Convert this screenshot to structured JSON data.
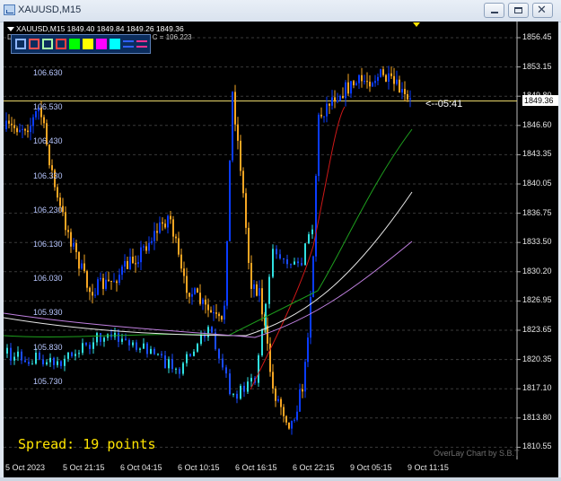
{
  "window": {
    "title": "XAUUSD,M15",
    "app_icon": "chart-icon",
    "controls": [
      "minimize-icon",
      "maximize-icon",
      "close-icon"
    ]
  },
  "chart": {
    "info_line": "XAUUSD,M15  1849.40 1849.84 1849.26 1849.36",
    "indicator_line": "D",
    "indicator_suffix": "103, C = 106.223",
    "current_price": "1849.36",
    "bar_timer": "<--05:41",
    "spread_text": "Spread: 19 points",
    "watermark": "OverLay Chart by S.B.T",
    "colors": {
      "background": "#000000",
      "bull": "#0a3cff",
      "bear": "#f5a623",
      "overlay": "#30e0e0",
      "ma_red": "#d01818",
      "ma_green": "#1ea01e",
      "ma_white": "#e8e8e8",
      "ma_violet": "#c080e0"
    },
    "toolbar_swatches": [
      {
        "name": "toolbar-swatch-1",
        "color": "#8fb6ff",
        "style": "outline"
      },
      {
        "name": "toolbar-swatch-2",
        "color": "#ff5050",
        "style": "outline"
      },
      {
        "name": "toolbar-swatch-3",
        "color": "#a8ffa8",
        "style": "outline"
      },
      {
        "name": "toolbar-swatch-4",
        "color": "#ff4040",
        "style": "outline"
      },
      {
        "name": "toolbar-swatch-5",
        "color": "#00ff00",
        "style": "fill"
      },
      {
        "name": "toolbar-swatch-6",
        "color": "#ffff00",
        "style": "fill"
      },
      {
        "name": "toolbar-swatch-7",
        "color": "#ff00ff",
        "style": "fill"
      },
      {
        "name": "toolbar-swatch-8",
        "color": "#00ffff",
        "style": "fill"
      },
      {
        "name": "toolbar-swatch-9",
        "color": "#3060ff",
        "style": "line"
      },
      {
        "name": "toolbar-swatch-10",
        "color": "#ff3090",
        "style": "line"
      }
    ]
  },
  "chart_data": {
    "type": "candlestick",
    "right_axis_labels": [
      "1856.45",
      "1853.15",
      "1849.80",
      "1846.60",
      "1843.35",
      "1840.05",
      "1836.75",
      "1833.50",
      "1830.20",
      "1826.95",
      "1823.65",
      "1820.35",
      "1817.10",
      "1813.80",
      "1810.55"
    ],
    "left_axis_labels": [
      "106.630",
      "106.530",
      "106.430",
      "106.330",
      "106.230",
      "106.130",
      "106.030",
      "105.930",
      "105.830",
      "105.730"
    ],
    "x_labels": [
      "5 Oct 2023",
      "5 Oct 21:15",
      "6 Oct 04:15",
      "6 Oct 10:15",
      "6 Oct 16:15",
      "6 Oct 22:15",
      "9 Oct 05:15",
      "9 Oct 11:15"
    ],
    "ylim": [
      1810.55,
      1856.45
    ],
    "last_price": 1849.36
  }
}
